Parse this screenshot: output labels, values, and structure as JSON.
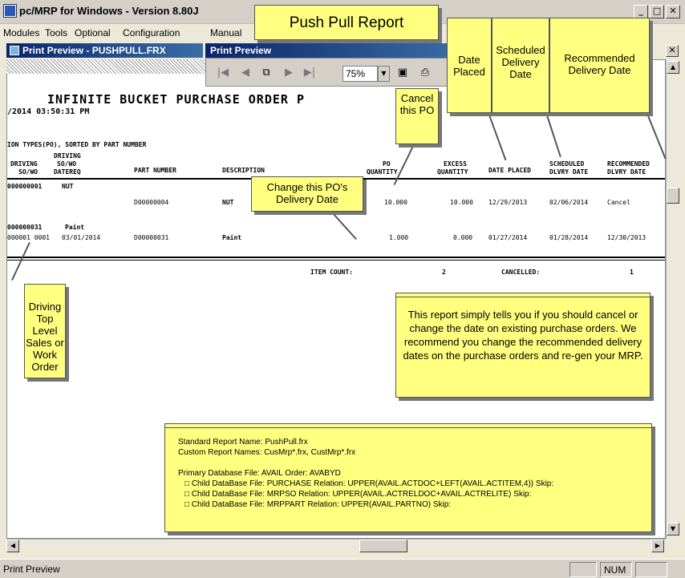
{
  "window": {
    "title": "pc/MRP for Windows - Version 8.80J"
  },
  "menubar": [
    "Modules",
    "Tools",
    "Optional",
    "Configuration",
    "Manual"
  ],
  "child_window": {
    "title": "Print Preview - PUSHPULL.FRX"
  },
  "print_preview": {
    "title": "Print Preview",
    "zoom": "75%"
  },
  "report": {
    "title": "INFINITE BUCKET PURCHASE ORDER P",
    "printed_on": "/2014 03:50:31 PM",
    "subheader": "ION TYPES(PO), SORTED BY PART NUMBER",
    "columns": {
      "driving_label": "DRIVING",
      "driving_sub": "SO/WO",
      "driving2_label": "DRIVING",
      "driving2_sub": "SO/WO",
      "driving2_sub2": "DATEREQ",
      "part_number": "PART NUMBER",
      "description": "DESCRIPTION",
      "po_label": "PO",
      "po_qty": "QUANTITY",
      "excess_label": "EXCESS",
      "excess_qty": "QUANTITY",
      "date_placed": "DATE PLACED",
      "scheduled_label": "SCHEDULED",
      "scheduled_sub": "DLVRY DATE",
      "recommended_label": "RECOMMENDED",
      "recommended_sub": "DLVRY DATE"
    },
    "rows": [
      {
        "po": "000000001",
        "driving": "NUT",
        "part": "D00000004",
        "desc": "NUT",
        "qty": "10.000",
        "excess": "10.000",
        "placed": "12/29/2013",
        "sched": "02/06/2014",
        "rec": "Cancel"
      },
      {
        "po": "000000031",
        "driving": "Paint",
        "seq": "000001  0001",
        "date_req": "03/01/2014",
        "part": "D00000031",
        "desc": "Paint",
        "qty": "1.000",
        "excess": "0.000",
        "placed": "01/27/2014",
        "sched": "01/28/2014",
        "rec": "12/30/2013"
      }
    ],
    "footer": {
      "item_count_label": "ITEM COUNT:",
      "item_count": "2",
      "cancelled_label": "CANCELLED:",
      "cancelled": "1"
    }
  },
  "callouts": {
    "push_pull_title": "Push Pull Report",
    "date_placed": "Date Placed",
    "scheduled_delivery": "Scheduled Delivery Date",
    "recommended_delivery": "Recommended Delivery Date",
    "cancel_po": "Cancel this PO",
    "change_date": "Change this PO's Delivery Date",
    "driving_order": "Driving Top Level Sales or Work Order",
    "description": "This report simply tells you if you should cancel or change the date on existing purchase orders.  We recommend you change the recommended delivery dates on the purchase orders and re-gen your MRP.",
    "info": {
      "line1": "Standard Report Name: PushPull.frx",
      "line2": "Custom Report Names: CusMrp*.frx, CustMrp*.frx",
      "line3": "Primary Database File: AVAIL Order: AVABYD",
      "line4": "□ Child DataBase File: PURCHASE Relation: UPPER(AVAIL.ACTDOC+LEFT(AVAIL.ACTITEM,4)) Skip:",
      "line5": "□ Child DataBase File: MRPSO Relation: UPPER(AVAIL.ACTRELDOC+AVAIL.ACTRELITE) Skip:",
      "line6": "□ Child DataBase File: MRPPART Relation: UPPER(AVAIL.PARTNO) Skip:"
    }
  },
  "statusbar": {
    "text": "Print Preview",
    "num": "NUM"
  },
  "colors": {
    "note": "#ffff80",
    "titlebar_active": "#0a246a"
  }
}
